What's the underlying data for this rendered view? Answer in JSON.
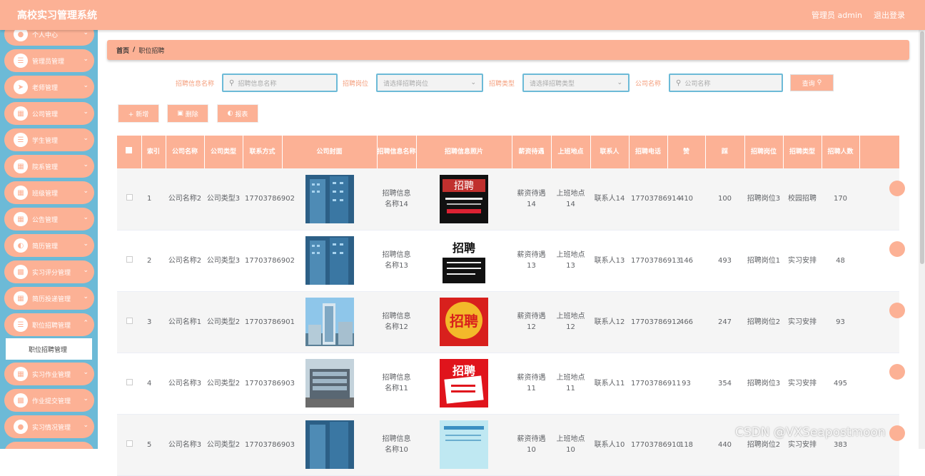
{
  "app": {
    "title": "高校实习管理系统",
    "user_label": "管理员 admin",
    "logout": "退出登录"
  },
  "sidebar": {
    "items": [
      {
        "label": "个人中心"
      },
      {
        "label": "管理员管理"
      },
      {
        "label": "老师管理"
      },
      {
        "label": "公司管理"
      },
      {
        "label": "学生管理"
      },
      {
        "label": "院系管理"
      },
      {
        "label": "班级管理"
      },
      {
        "label": "公告管理"
      },
      {
        "label": "简历管理"
      },
      {
        "label": "实习评分管理"
      },
      {
        "label": "简历投递管理"
      },
      {
        "label": "职位招聘管理"
      },
      {
        "label": "实习作业管理"
      },
      {
        "label": "作业提交管理"
      },
      {
        "label": "实习情况管理"
      }
    ],
    "active_sub": "职位招聘管理"
  },
  "breadcrumb": {
    "home": "首页",
    "sep": "/",
    "current": "职位招聘"
  },
  "search": {
    "label1": "招聘信息名称",
    "placeholder1": "招聘信息名称",
    "label2": "招聘岗位",
    "placeholder2": "请选择招聘岗位",
    "label3": "招聘类型",
    "placeholder3": "请选择招聘类型",
    "label4": "公司名称",
    "placeholder4": "公司名称",
    "query": "查询"
  },
  "actions": {
    "add": "+ 新增",
    "delete": "删除",
    "report": "报表"
  },
  "table": {
    "headers": [
      "索引",
      "公司名称",
      "公司类型",
      "联系方式",
      "公司封面",
      "招聘信息名称",
      "招聘信息照片",
      "薪资待遇",
      "上班地点",
      "联系人",
      "招聘电话",
      "赞",
      "踩",
      "招聘岗位",
      "招聘类型",
      "招聘人数"
    ],
    "rows": [
      {
        "idx": "1",
        "company": "公司名称2",
        "type": "公司类型3",
        "phone": "17703786902",
        "name": "招聘信息名称14",
        "salary": "薪资待遇14",
        "place": "上班地点14",
        "contact": "联系人14",
        "tel": "17703786914",
        "zan": "410",
        "cai": "100",
        "post": "招聘岗位3",
        "rtype": "校园招聘",
        "count": "170"
      },
      {
        "idx": "2",
        "company": "公司名称2",
        "type": "公司类型3",
        "phone": "17703786902",
        "name": "招聘信息名称13",
        "salary": "薪资待遇13",
        "place": "上班地点13",
        "contact": "联系人13",
        "tel": "17703786913",
        "zan": "146",
        "cai": "493",
        "post": "招聘岗位1",
        "rtype": "实习安排",
        "count": "48"
      },
      {
        "idx": "3",
        "company": "公司名称1",
        "type": "公司类型2",
        "phone": "17703786901",
        "name": "招聘信息名称12",
        "salary": "薪资待遇12",
        "place": "上班地点12",
        "contact": "联系人12",
        "tel": "17703786912",
        "zan": "466",
        "cai": "247",
        "post": "招聘岗位2",
        "rtype": "实习安排",
        "count": "93"
      },
      {
        "idx": "4",
        "company": "公司名称3",
        "type": "公司类型2",
        "phone": "17703786903",
        "name": "招聘信息名称11",
        "salary": "薪资待遇11",
        "place": "上班地点11",
        "contact": "联系人11",
        "tel": "17703786911",
        "zan": "93",
        "cai": "354",
        "post": "招聘岗位3",
        "rtype": "实习安排",
        "count": "495"
      },
      {
        "idx": "5",
        "company": "公司名称3",
        "type": "公司类型2",
        "phone": "17703786903",
        "name": "招聘信息名称10",
        "salary": "薪资待遇10",
        "place": "上班地点10",
        "contact": "联系人10",
        "tel": "17703786910",
        "zan": "118",
        "cai": "440",
        "post": "招聘岗位2",
        "rtype": "实习安排",
        "count": "383"
      }
    ]
  },
  "poster_texts": {
    "p1": "招聘",
    "p2": "招聘",
    "p3": "招聘",
    "p4": "招聘"
  },
  "watermark": "CSDN @VXSeapostmoon",
  "colors": {
    "primary": "#fcb195",
    "sidebar": "#6cbad7"
  }
}
